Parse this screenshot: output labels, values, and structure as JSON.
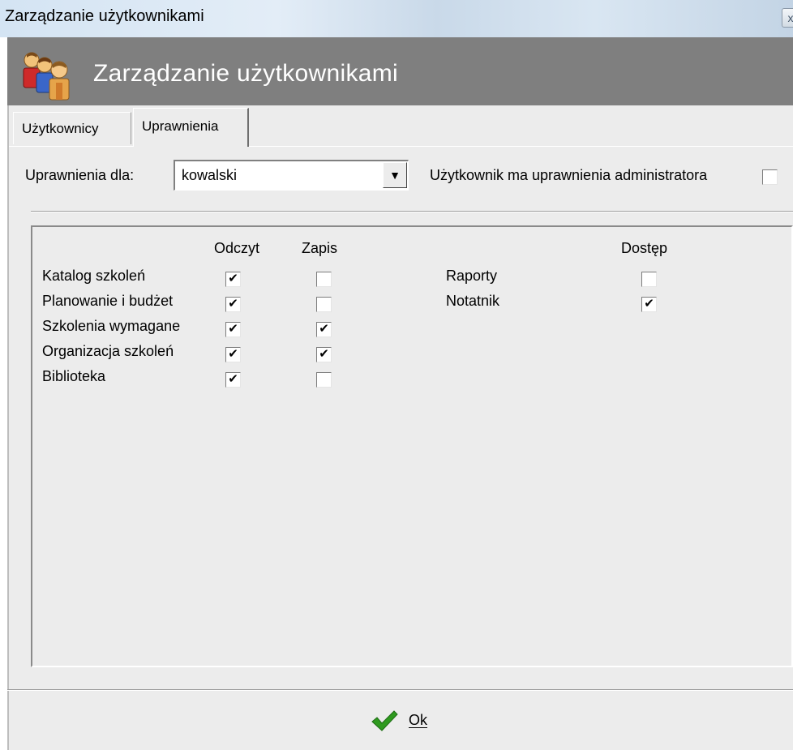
{
  "window": {
    "title": "Zarządzanie użytkownikami",
    "close_glyph": "x"
  },
  "header": {
    "title": "Zarządzanie użytkownikami",
    "icon": "users-icon"
  },
  "tabs": [
    {
      "label": "Użytkownicy",
      "selected": false
    },
    {
      "label": "Uprawnienia",
      "selected": true
    }
  ],
  "permissions_for": {
    "label": "Uprawnienia dla:",
    "selected_user": "kowalski",
    "dropdown_glyph": "▼"
  },
  "admin": {
    "label": "Użytkownik ma uprawnienia administratora",
    "checked": false
  },
  "modules": {
    "headers": {
      "read": "Odczyt",
      "write": "Zapis"
    },
    "rows": [
      {
        "label": "Katalog szkoleń",
        "read": true,
        "write": false
      },
      {
        "label": "Planowanie i budżet",
        "read": true,
        "write": false
      },
      {
        "label": "Szkolenia wymagane",
        "read": true,
        "write": true
      },
      {
        "label": "Organizacja szkoleń",
        "read": true,
        "write": true
      },
      {
        "label": "Biblioteka",
        "read": true,
        "write": false
      }
    ]
  },
  "access": {
    "header": "Dostęp",
    "rows": [
      {
        "label": "Raporty",
        "access": false
      },
      {
        "label": "Notatnik",
        "access": true
      }
    ]
  },
  "check_glyph": "✔",
  "footer": {
    "ok_label": "Ok",
    "ok_icon": "checkmark-icon",
    "ok_icon_color": "#2f9a1f"
  },
  "colors": {
    "header_band": "#7f7f7f",
    "dialog_background": "#ececec"
  }
}
